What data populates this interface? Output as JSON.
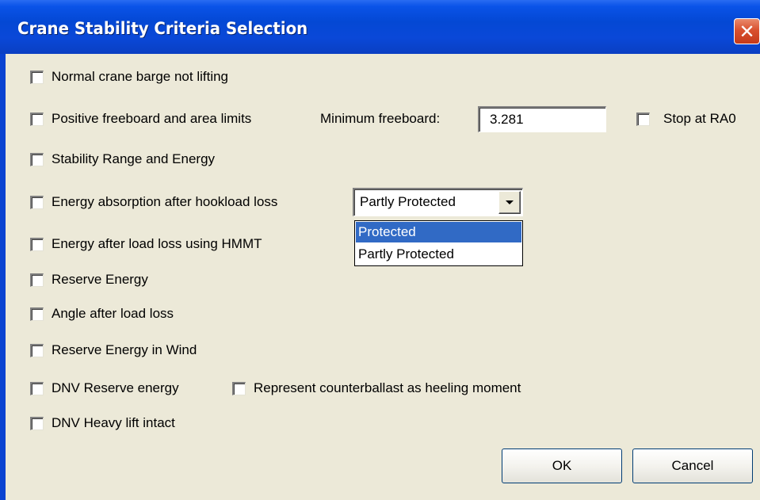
{
  "window": {
    "title": "Crane Stability Criteria Selection",
    "close_label": "✕"
  },
  "criteria": [
    {
      "label": "Normal crane barge not lifting",
      "checked": false
    },
    {
      "label": "Positive freeboard and area limits",
      "checked": false
    },
    {
      "label": "Stability Range and Energy",
      "checked": false
    },
    {
      "label": "Energy absorption after hookload loss",
      "checked": false
    },
    {
      "label": "Energy after load loss using HMMT",
      "checked": false
    },
    {
      "label": "Reserve Energy",
      "checked": false
    },
    {
      "label": "Angle after load loss",
      "checked": false
    },
    {
      "label": "Reserve Energy in Wind",
      "checked": false
    },
    {
      "label": "DNV Reserve energy",
      "checked": false
    },
    {
      "label": "DNV Heavy lift intact",
      "checked": false
    }
  ],
  "freeboard": {
    "label": "Minimum freeboard:",
    "value": "3.281"
  },
  "stop_at_ra0": {
    "label": "Stop at RA0",
    "checked": false
  },
  "counterballast": {
    "label": "Represent counterballast as heeling moment",
    "checked": false
  },
  "protection_select": {
    "value": "Partly Protected",
    "options": [
      "Protected",
      "Partly Protected"
    ],
    "highlighted": "Protected"
  },
  "buttons": {
    "ok": "OK",
    "cancel": "Cancel"
  },
  "colors": {
    "titlebar": "#0a53e8",
    "dialog_bg": "#ece9d8",
    "selection": "#316ac5",
    "close_button": "#d9512f"
  }
}
